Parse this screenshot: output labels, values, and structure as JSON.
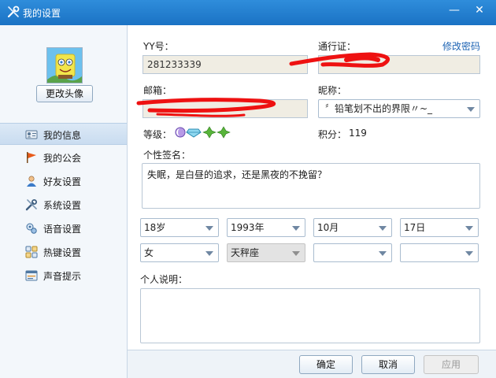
{
  "window": {
    "title": "我的设置",
    "minimize_glyph": "—",
    "close_glyph": "✕"
  },
  "sidebar": {
    "change_avatar_label": "更改头像",
    "items": [
      {
        "label": "我的信息",
        "icon": "profile-card-icon"
      },
      {
        "label": "我的公会",
        "icon": "flag-icon"
      },
      {
        "label": "好友设置",
        "icon": "friend-icon"
      },
      {
        "label": "系统设置",
        "icon": "tools-icon"
      },
      {
        "label": "语音设置",
        "icon": "voice-icon"
      },
      {
        "label": "热键设置",
        "icon": "hotkey-icon"
      },
      {
        "label": "声音提示",
        "icon": "sound-alert-icon"
      }
    ],
    "active_index": 0
  },
  "profile": {
    "yy_label": "YY号：",
    "yy_value": "281233339",
    "passport_label": "通行证：",
    "change_password_label": "修改密码",
    "email_label": "邮箱：",
    "nickname_label": "昵称：",
    "nickname_value": "〞铅笔划不出的界限〃~_",
    "level_label": "等级：",
    "points_label": "积分：",
    "points_value": "119",
    "signature_label": "个性签名：",
    "signature_value": "失眠，是白昼的追求，还是黑夜的不挽留？",
    "age": "18岁",
    "year": "1993年",
    "month": "10月",
    "day": "17日",
    "gender": "女",
    "zodiac": "天秤座",
    "location_1": "",
    "location_2": "",
    "description_label": "个人说明："
  },
  "footer": {
    "ok_label": "确定",
    "cancel_label": "取消",
    "apply_label": "应用"
  },
  "colors": {
    "titlebar": "#1f7bd0",
    "link": "#1e64b4",
    "redaction": "#ee1111"
  }
}
